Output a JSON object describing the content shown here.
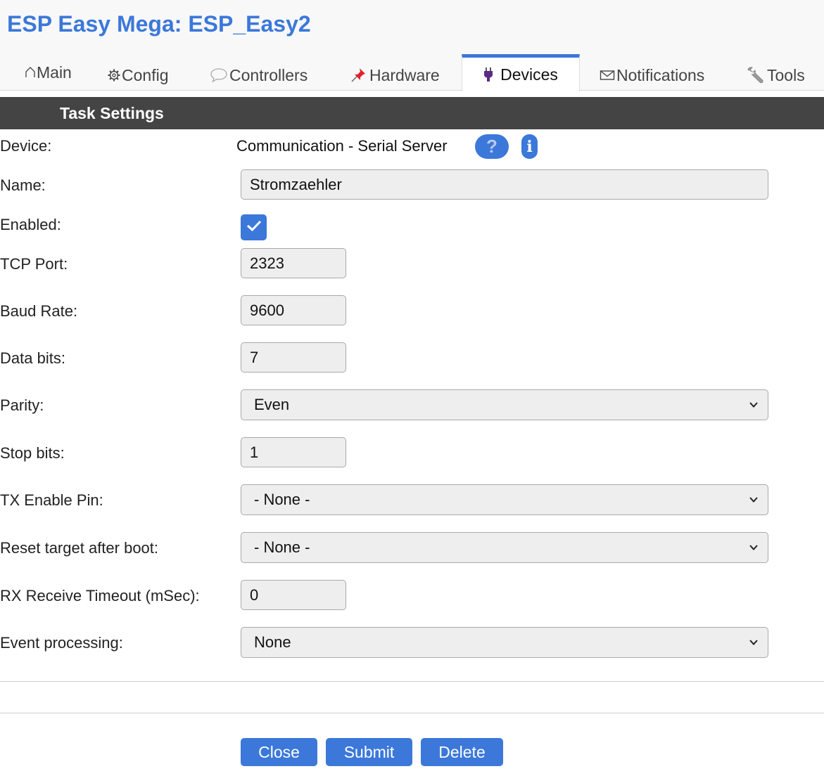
{
  "app": {
    "title": "ESP Easy Mega: ESP_Easy2"
  },
  "tabs": [
    {
      "label": "Main",
      "icon": "home-icon"
    },
    {
      "label": "Config",
      "icon": "gear-icon"
    },
    {
      "label": "Controllers",
      "icon": "speech-bubble-icon"
    },
    {
      "label": "Hardware",
      "icon": "pushpin-icon"
    },
    {
      "label": "Devices",
      "icon": "plug-icon",
      "active": true
    },
    {
      "label": "Notifications",
      "icon": "envelope-icon"
    },
    {
      "label": "Tools",
      "icon": "wrench-icon"
    }
  ],
  "section": {
    "title": "Task Settings"
  },
  "form": {
    "device": {
      "label": "Device:",
      "value": "Communication - Serial Server",
      "help_symbol": "?",
      "info_symbol": "i"
    },
    "name": {
      "label": "Name:",
      "value": "Stromzaehler"
    },
    "enabled": {
      "label": "Enabled:",
      "checked": true
    },
    "tcp_port": {
      "label": "TCP Port:",
      "value": "2323"
    },
    "baud_rate": {
      "label": "Baud Rate:",
      "value": "9600"
    },
    "data_bits": {
      "label": "Data bits:",
      "value": "7"
    },
    "parity": {
      "label": "Parity:",
      "selected": "Even"
    },
    "stop_bits": {
      "label": "Stop bits:",
      "value": "1"
    },
    "tx_enable_pin": {
      "label": "TX Enable Pin:",
      "selected": "- None -"
    },
    "reset_target": {
      "label": "Reset target after boot:",
      "selected": "- None -"
    },
    "rx_timeout": {
      "label": "RX Receive Timeout (mSec):",
      "value": "0"
    },
    "event_processing": {
      "label": "Event processing:",
      "selected": "None"
    }
  },
  "buttons": {
    "close": "Close",
    "submit": "Submit",
    "delete": "Delete"
  },
  "colors": {
    "accent": "#3b78d9",
    "header_bar": "#444444",
    "field_bg": "#eeeeee"
  }
}
